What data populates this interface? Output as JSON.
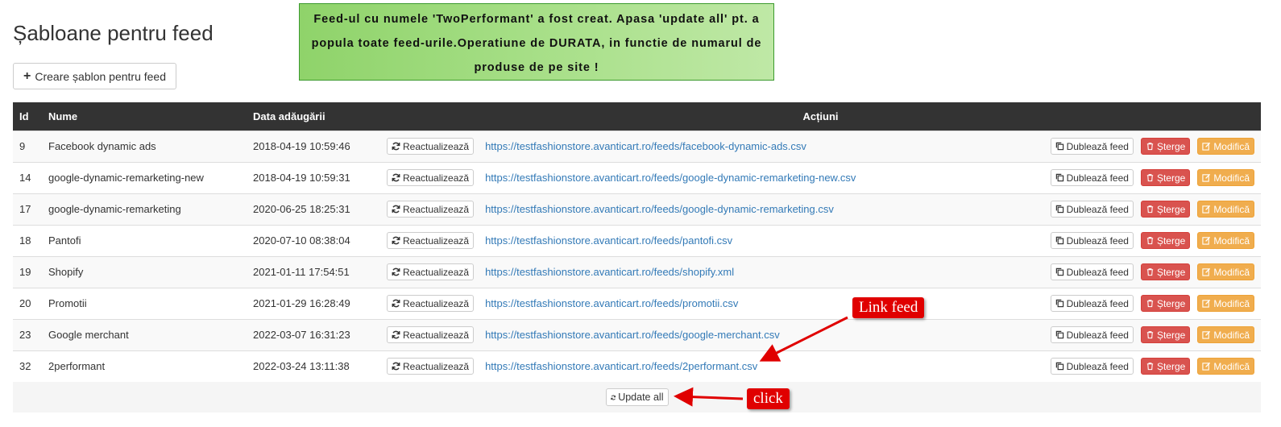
{
  "header": {
    "title": "Șabloane pentru feed",
    "create_button": "Creare șablon pentru feed"
  },
  "alert": {
    "message": "Feed-ul cu numele 'TwoPerformant' a fost creat. Apasa 'update all' pt. a popula toate feed-urile.Operatiune de DURATA, in functie de numarul de produse de pe site !"
  },
  "table": {
    "columns": {
      "id": "Id",
      "name": "Nume",
      "date": "Data adăugării",
      "actions": "Acțiuni"
    },
    "labels": {
      "refresh": "Reactualizează",
      "duplicate": "Dublează feed",
      "delete": "Șterge",
      "edit": "Modifică"
    },
    "rows": [
      {
        "id": "9",
        "name": "Facebook dynamic ads",
        "date": "2018-04-19 10:59:46",
        "url": "https://testfashionstore.avanticart.ro/feeds/facebook-dynamic-ads.csv"
      },
      {
        "id": "14",
        "name": "google-dynamic-remarketing-new",
        "date": "2018-04-19 10:59:31",
        "url": "https://testfashionstore.avanticart.ro/feeds/google-dynamic-remarketing-new.csv"
      },
      {
        "id": "17",
        "name": "google-dynamic-remarketing",
        "date": "2020-06-25 18:25:31",
        "url": "https://testfashionstore.avanticart.ro/feeds/google-dynamic-remarketing.csv"
      },
      {
        "id": "18",
        "name": "Pantofi",
        "date": "2020-07-10 08:38:04",
        "url": "https://testfashionstore.avanticart.ro/feeds/pantofi.csv"
      },
      {
        "id": "19",
        "name": "Shopify",
        "date": "2021-01-11 17:54:51",
        "url": "https://testfashionstore.avanticart.ro/feeds/shopify.xml"
      },
      {
        "id": "20",
        "name": "Promotii",
        "date": "2021-01-29 16:28:49",
        "url": "https://testfashionstore.avanticart.ro/feeds/promotii.csv"
      },
      {
        "id": "23",
        "name": "Google merchant",
        "date": "2022-03-07 16:31:23",
        "url": "https://testfashionstore.avanticart.ro/feeds/google-merchant.csv"
      },
      {
        "id": "32",
        "name": "2performant",
        "date": "2022-03-24 13:11:38",
        "url": "https://testfashionstore.avanticart.ro/feeds/2performant.csv"
      }
    ],
    "update_all": "Update all"
  },
  "annotations": {
    "link_feed": "Link feed",
    "click": "click",
    "color": "#e00000"
  }
}
